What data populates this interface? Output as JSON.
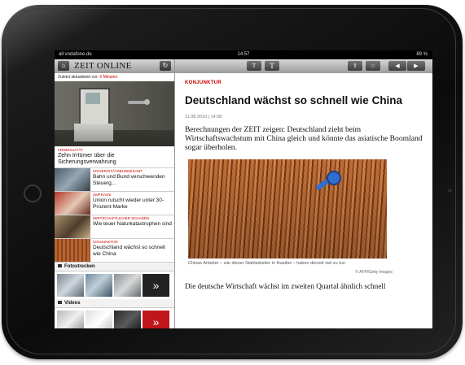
{
  "status_bar": {
    "carrier": "all vodafone.de",
    "time": "14:57",
    "battery": "89 %"
  },
  "left_pane": {
    "logo_text": "ZEIT ONLINE",
    "updated_prefix": "Zuletzt aktualisiert vor:",
    "updated_value": "6 Minuten",
    "lead": {
      "kicker": "KRIMINALITÄT",
      "title": "Zehn Irrtümer über die Sicherungsverwahrung"
    },
    "news": [
      {
        "kicker": "UNIVERSITÄTSBUNDESAMT",
        "title": "Bahn und Bund verschwenden Steuerg..."
      },
      {
        "kicker": "UMFRAGE",
        "title": "Union rutscht wieder unter 30-Prozent-Marke"
      },
      {
        "kicker": "WIRTSCHAFTLICHER SCHADEN",
        "title": "Wie teuer Naturkatastrophen sind"
      },
      {
        "kicker": "KONJUNKTUR",
        "title": "Deutschland wächst so schnell wie China"
      }
    ],
    "sections": {
      "photos": "Fotostrecken",
      "videos": "Videos"
    },
    "more_glyph": "»"
  },
  "right_pane": {
    "toolbar": {
      "font_smaller": "T",
      "font_larger": "T",
      "share_icon": "share-icon",
      "star_icon": "star-icon",
      "prev": "◀",
      "next": "▶"
    },
    "article": {
      "kicker": "KONJUNKTUR",
      "headline": "Deutschland wächst so schnell wie China",
      "date": "11.08.2010 | 14:08",
      "teaser": "Berechnungen der ZEIT zeigen: Deutschland zieht beim Wirtschaftswachstum mit China gleich und könnte das asiatische Boomland sogar überholen.",
      "caption": "Chinas Arbeiter – wie dieser Stahlarbeiter in Huaibei – haben derzeit viel zu tun",
      "credit": "© AFP/Getty Images",
      "body": "Die deutsche Wirtschaft wächst im zweiten Quartal ähnlich schnell"
    }
  },
  "colors": {
    "accent_red": "#cc0000",
    "frame": "#111111"
  }
}
